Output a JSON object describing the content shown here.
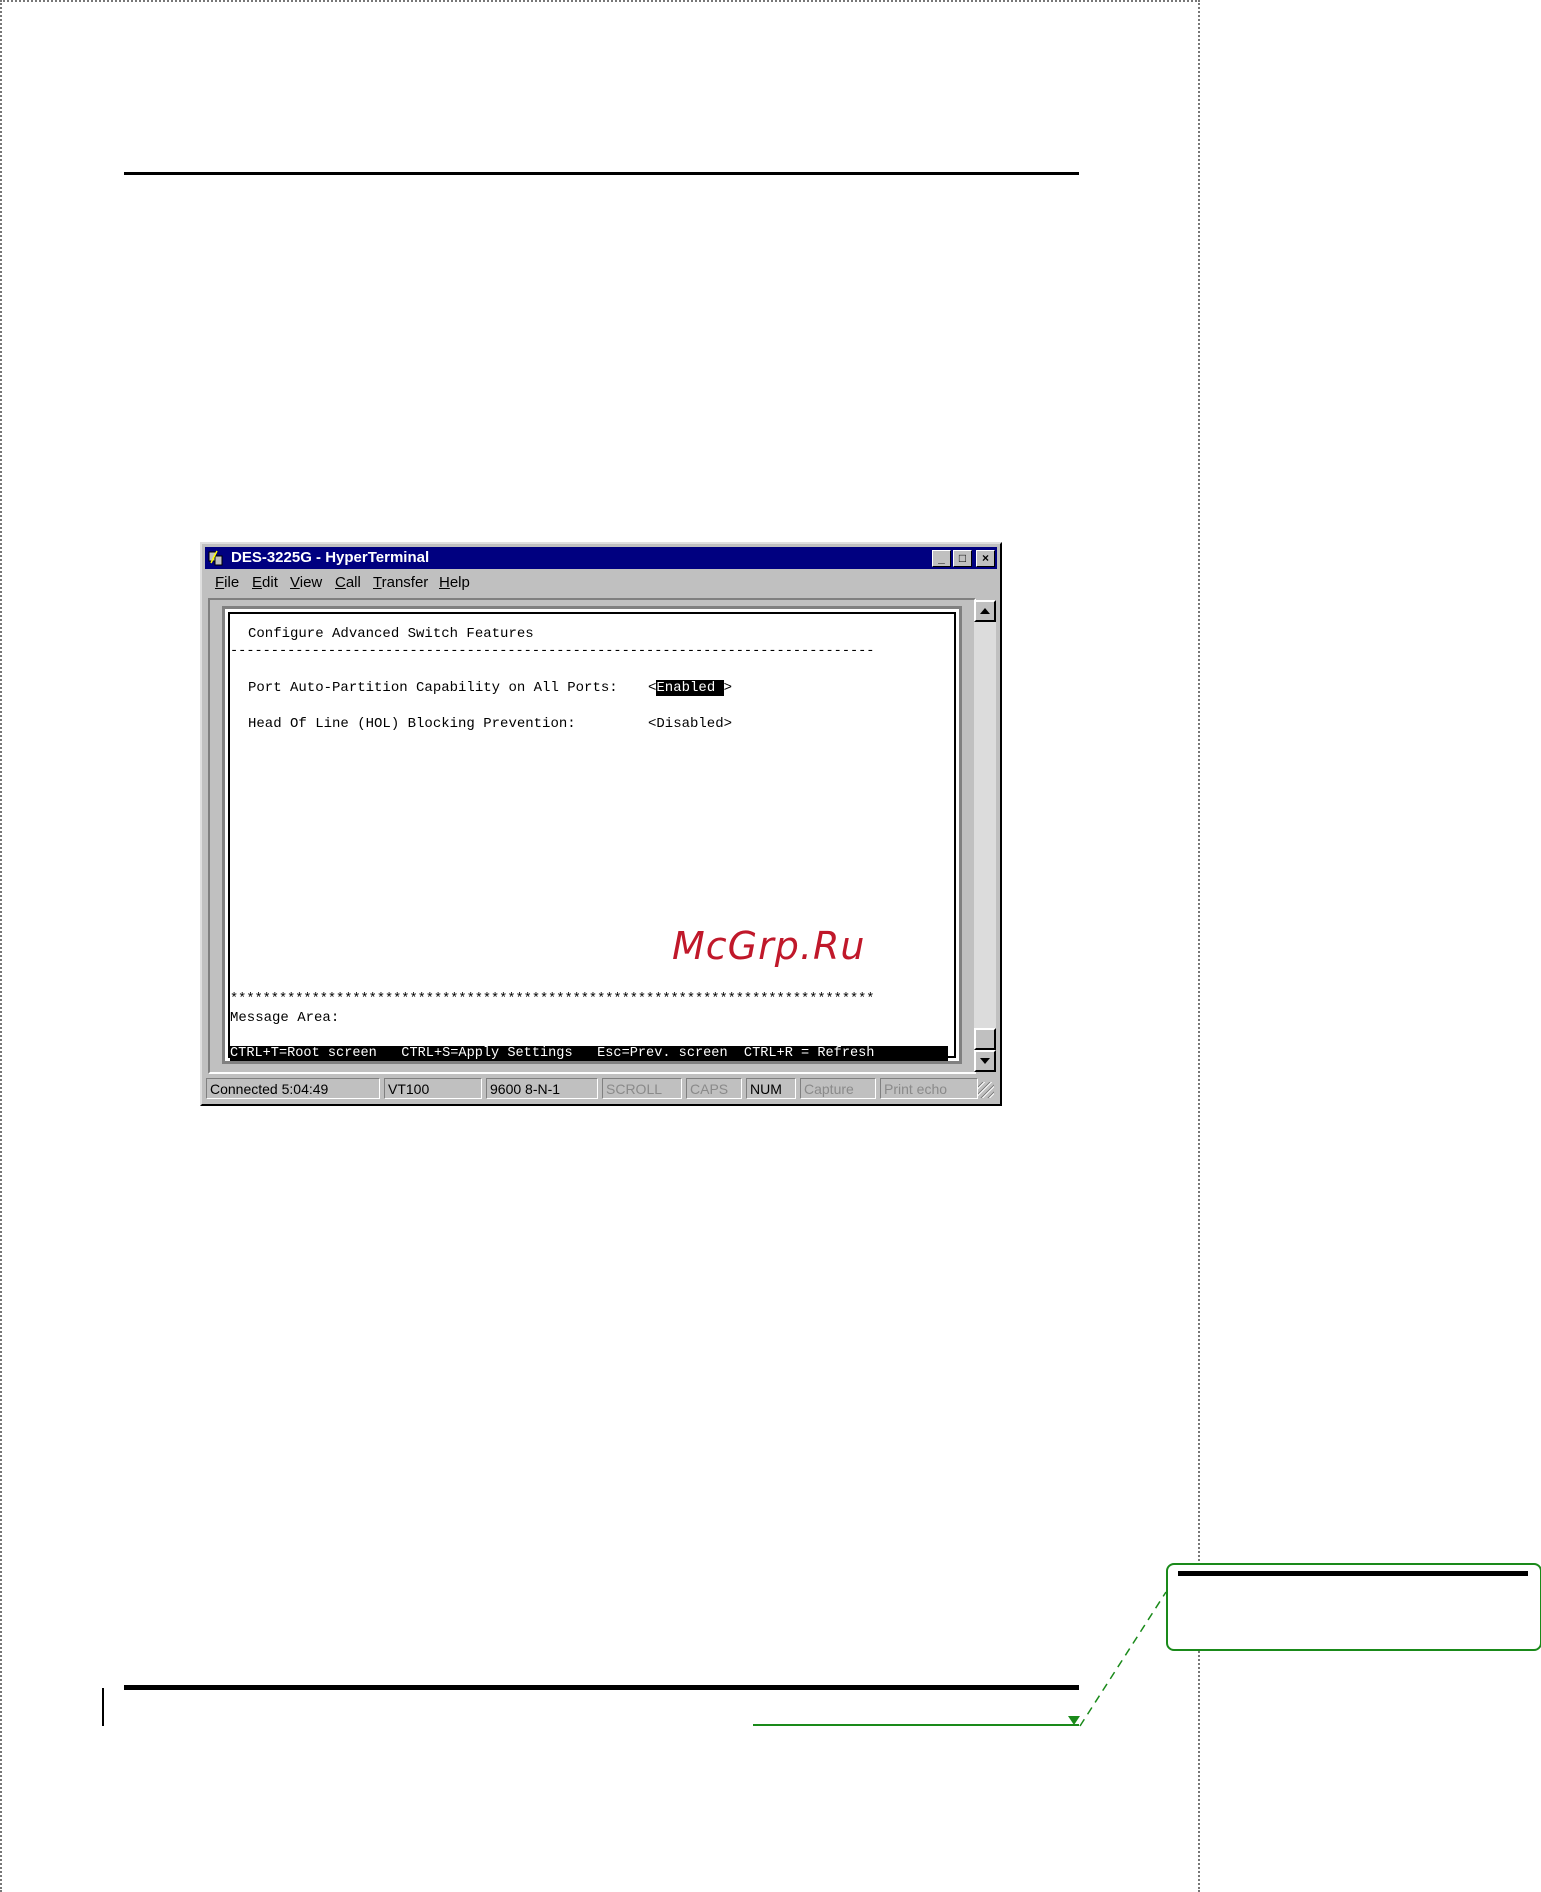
{
  "window": {
    "title": "DES-3225G - HyperTerminal",
    "controls": {
      "minimize": "_",
      "maximize": "□",
      "close": "×"
    }
  },
  "menu": [
    {
      "label": "File",
      "ul": "F",
      "rest": "ile"
    },
    {
      "label": "Edit",
      "ul": "E",
      "rest": "dit"
    },
    {
      "label": "View",
      "ul": "V",
      "rest": "iew"
    },
    {
      "label": "Call",
      "ul": "C",
      "rest": "all"
    },
    {
      "label": "Transfer",
      "ul": "T",
      "rest": "ransfer"
    },
    {
      "label": "Help",
      "ul": "H",
      "rest": "elp"
    }
  ],
  "terminal": {
    "heading": "Configure Advanced Switch Features",
    "dash_line": "-------------------------------------------------------------------------------",
    "settings": [
      {
        "label": "Port Auto-Partition Capability on All Ports:",
        "value_prefix": "<",
        "value": "Enabled ",
        "value_suffix": ">",
        "selected": true
      },
      {
        "label": "Head Of Line (HOL) Blocking Prevention:",
        "value_prefix": "",
        "value": "<Disabled>",
        "value_suffix": "",
        "selected": false
      }
    ],
    "star_line": "*******************************************************************************",
    "message_area_label": "Message Area:",
    "shortcuts": "CTRL+T=Root screen   CTRL+S=Apply Settings   Esc=Prev. screen  CTRL+R = Refresh"
  },
  "statusbar": {
    "connected": "Connected 5:04:49",
    "emulation": "VT100",
    "port_settings": "9600 8-N-1",
    "scroll": "SCROLL",
    "caps": "CAPS",
    "num": "NUM",
    "capture": "Capture",
    "print_echo": "Print echo"
  },
  "watermark": "McGrp.Ru",
  "colors": {
    "titlebar": "#000080",
    "chrome": "#c0c0c0",
    "accent_green": "#1a8a1a",
    "watermark": "#c0182a"
  }
}
